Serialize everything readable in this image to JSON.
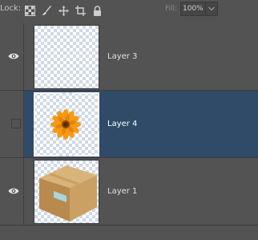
{
  "lock_bar": {
    "lock_label": "Lock:",
    "lock_icons": [
      "lock-transparent-pixels-icon",
      "lock-image-pixels-icon",
      "lock-position-icon",
      "lock-artboard-icon",
      "lock-all-icon"
    ],
    "fill_label": "Fill:",
    "fill_value": "100%"
  },
  "layers": [
    {
      "name": "Layer 3",
      "visible": true,
      "selected": false,
      "content": "empty-transparent"
    },
    {
      "name": "Layer 4",
      "visible": false,
      "selected": true,
      "content": "orange-flower"
    },
    {
      "name": "Layer 1",
      "visible": true,
      "selected": false,
      "content": "cardboard-box"
    }
  ],
  "colors": {
    "panel_background": "#535353",
    "selected_row": "#2f4b68",
    "divider": "#3e3e3e"
  }
}
